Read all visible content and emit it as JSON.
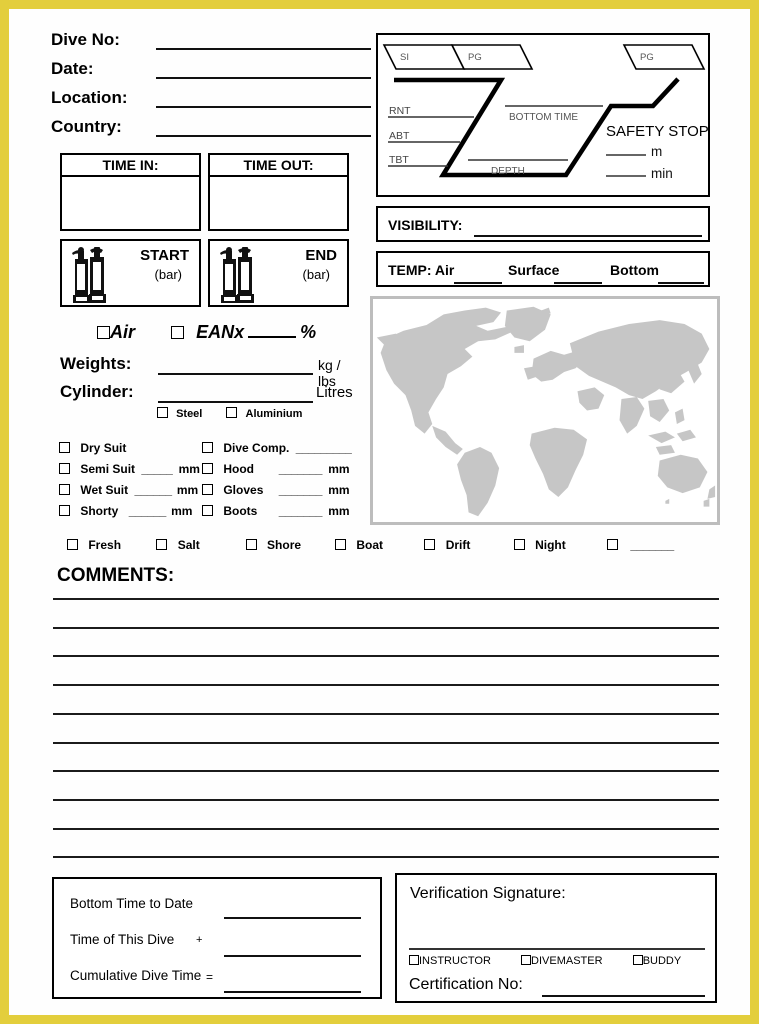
{
  "page": {
    "border_color": "#E3CE3C",
    "background": "#FEFEFE"
  },
  "header": {
    "fields": [
      {
        "label": "Dive No:"
      },
      {
        "label": "Date:"
      },
      {
        "label": "Location:"
      },
      {
        "label": "Country:"
      }
    ]
  },
  "time_boxes": {
    "time_in": "TIME IN:",
    "time_out": "TIME OUT:"
  },
  "tanks": {
    "start_label": "START",
    "start_unit": "(bar)",
    "end_label": "END",
    "end_unit": "(bar)",
    "icon": "scuba-tank-icon"
  },
  "gas": {
    "air_label": "Air",
    "eanx_label": "EANx",
    "percent_symbol": "%",
    "blank": "_____"
  },
  "weights": {
    "label": "Weights:",
    "unit": "kg / lbs"
  },
  "cylinder": {
    "label": "Cylinder:",
    "unit": "Litres",
    "material_options": [
      {
        "label": "Steel"
      },
      {
        "label": "Aluminium"
      }
    ]
  },
  "equipment": {
    "left": [
      {
        "label": "Dry Suit",
        "fill": "",
        "unit": ""
      },
      {
        "label": "Semi Suit",
        "fill": "_____",
        "unit": "mm"
      },
      {
        "label": "Wet Suit",
        "fill": "______",
        "unit": "mm"
      },
      {
        "label": "Shorty",
        "fill": "______",
        "unit": "mm"
      }
    ],
    "right": [
      {
        "label": "Dive Comp.",
        "fill": "_________",
        "unit": ""
      },
      {
        "label": "Hood",
        "fill": "_______",
        "unit": "mm"
      },
      {
        "label": "Gloves",
        "fill": "_______",
        "unit": "mm"
      },
      {
        "label": "Boots",
        "fill": "_______",
        "unit": "mm"
      }
    ]
  },
  "dive_types": [
    {
      "label": "Fresh"
    },
    {
      "label": "Salt"
    },
    {
      "label": "Shore"
    },
    {
      "label": "Boat"
    },
    {
      "label": "Drift"
    },
    {
      "label": "Night"
    },
    {
      "label": "_______"
    }
  ],
  "comments": {
    "title": "COMMENTS:",
    "line_count": 10
  },
  "profile": {
    "si": "SI",
    "pg_left": "PG",
    "pg_right": "PG",
    "rnt": "RNT",
    "abt": "ABT",
    "tbt": "TBT",
    "bottom_time": "BOTTOM TIME",
    "depth": "DEPTH",
    "safety_stop": "SAFETY STOP",
    "safety_unit_depth": "m",
    "safety_unit_time": "min"
  },
  "visibility": {
    "label": "VISIBILITY:"
  },
  "temp": {
    "label": "TEMP: Air",
    "surface": "Surface",
    "bottom": "Bottom"
  },
  "map": {
    "name": "world-map",
    "land_color": "#C6C6C6",
    "border_color": "#BDBDBD"
  },
  "time_totals": {
    "rows": [
      {
        "label": "Bottom Time to Date",
        "op": ""
      },
      {
        "label": "Time of This Dive",
        "op": "+"
      },
      {
        "label": "Cumulative Dive Time",
        "op": "="
      }
    ]
  },
  "verification": {
    "title": "Verification Signature:",
    "roles": [
      {
        "label": "INSTRUCTOR"
      },
      {
        "label": "DIVEMASTER"
      },
      {
        "label": "BUDDY"
      }
    ],
    "cert_label": "Certification No:"
  }
}
